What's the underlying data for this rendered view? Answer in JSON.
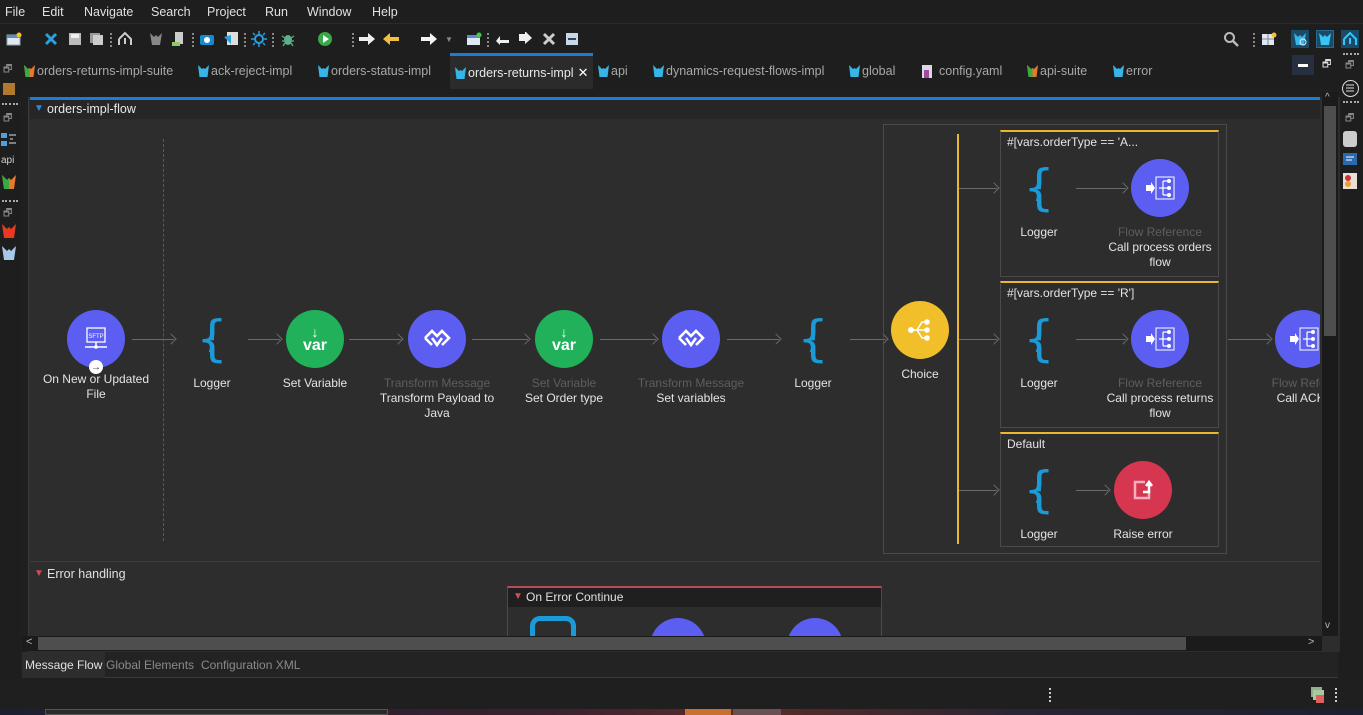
{
  "menu": [
    "File",
    "Edit",
    "Navigate",
    "Search",
    "Project",
    "Run",
    "Window",
    "Help"
  ],
  "tabs": [
    {
      "label": "orders-returns-impl-suite",
      "icon": "mule-suite-icon",
      "active": false
    },
    {
      "label": "ack-reject-impl",
      "icon": "mule-config-icon",
      "active": false
    },
    {
      "label": "orders-status-impl",
      "icon": "mule-config-icon",
      "active": false
    },
    {
      "label": "orders-returns-impl",
      "icon": "mule-config-icon",
      "active": true,
      "close": "✕"
    },
    {
      "label": "api",
      "icon": "mule-config-icon",
      "active": false
    },
    {
      "label": "dynamics-request-flows-impl",
      "icon": "mule-config-icon",
      "active": false
    },
    {
      "label": "global",
      "icon": "mule-config-icon",
      "active": false
    },
    {
      "label": "config.yaml",
      "icon": "yaml-file-icon",
      "active": false
    },
    {
      "label": "api-suite",
      "icon": "mule-suite-icon",
      "active": false
    },
    {
      "label": "error",
      "icon": "mule-config-icon",
      "active": false
    }
  ],
  "left_strip": {
    "api_label": "api"
  },
  "flow": {
    "name": "orders-impl-flow",
    "nodes": [
      {
        "type": "",
        "name": "On New or Updated File",
        "icon": "sftp-icon",
        "color": "#5b5ef0"
      },
      {
        "type": "",
        "name": "Logger",
        "icon": "logger-icon",
        "color": "#1a9ad6"
      },
      {
        "type": "",
        "name": "Set Variable",
        "icon": "set-variable-icon",
        "color": "#20b15a",
        "icon_text": "var"
      },
      {
        "type": "Transform Message",
        "name": "Transform Payload to Java",
        "icon": "transform-icon",
        "color": "#5b5ef0"
      },
      {
        "type": "Set Variable",
        "name": "Set Order type",
        "icon": "set-variable-icon",
        "color": "#20b15a",
        "icon_text": "var"
      },
      {
        "type": "Transform Message",
        "name": "Set variables",
        "icon": "transform-icon",
        "color": "#5b5ef0"
      },
      {
        "type": "",
        "name": "Logger",
        "icon": "logger-icon",
        "color": "#1a9ad6"
      },
      {
        "type": "",
        "name": "Choice",
        "icon": "choice-icon",
        "color": "#f0bf2a"
      }
    ],
    "routes": [
      {
        "condition": "#[vars.orderType == 'A...",
        "nodes": [
          {
            "type": "",
            "name": "Logger"
          },
          {
            "type": "Flow Reference",
            "name": "Call process orders flow"
          }
        ]
      },
      {
        "condition": "#[vars.orderType == 'R']",
        "nodes": [
          {
            "type": "",
            "name": "Logger"
          },
          {
            "type": "Flow Reference",
            "name": "Call process returns flow"
          }
        ]
      },
      {
        "condition": "Default",
        "nodes": [
          {
            "type": "",
            "name": "Logger"
          },
          {
            "type": "",
            "name": "Raise error",
            "color": "#d6364f"
          }
        ]
      }
    ],
    "after_choice": {
      "type": "Flow Refere",
      "name": "Call ACK f"
    }
  },
  "error_handling": {
    "title": "Error handling",
    "handler": "On Error Continue"
  },
  "bottom_tabs": [
    {
      "label": "Message Flow",
      "active": true
    },
    {
      "label": "Global Elements",
      "active": false
    },
    {
      "label": "Configuration XML",
      "active": false
    }
  ]
}
